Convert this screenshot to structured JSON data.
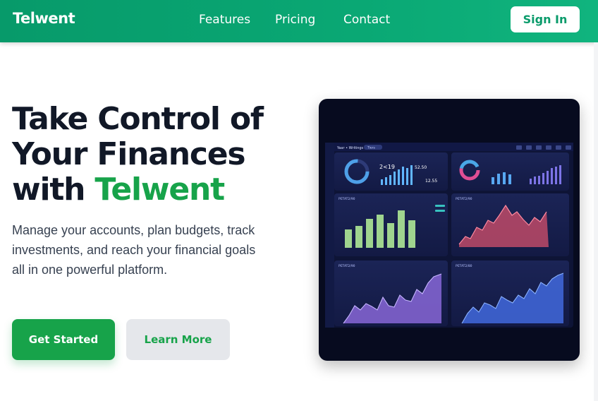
{
  "header": {
    "logo": "Telwent",
    "nav": [
      "Features",
      "Pricing",
      "Contact"
    ],
    "sign_in": "Sign In"
  },
  "hero": {
    "title_line1": "Take Control of",
    "title_line2": "Your Finances",
    "title_line3_prefix": "with ",
    "title_brand": "Telwent",
    "description": "Manage your accounts, plan budgets, track investments, and reach your financial goals all in one powerful platform.",
    "cta_primary": "Get Started",
    "cta_secondary": "Learn More"
  },
  "colors": {
    "header_green": "#0aa874",
    "brand_green": "#17a34a",
    "dashboard_bg": "#070b1f"
  },
  "dashboard_image": {
    "top_bar": "Yaar • Writings",
    "tab": "Tiers",
    "stats": [
      "2<19",
      "52.50",
      "12.55"
    ],
    "panels": [
      "PETAT2/90",
      "PETAT2/90",
      "PETAT2/90",
      "PETAT2/80"
    ]
  }
}
